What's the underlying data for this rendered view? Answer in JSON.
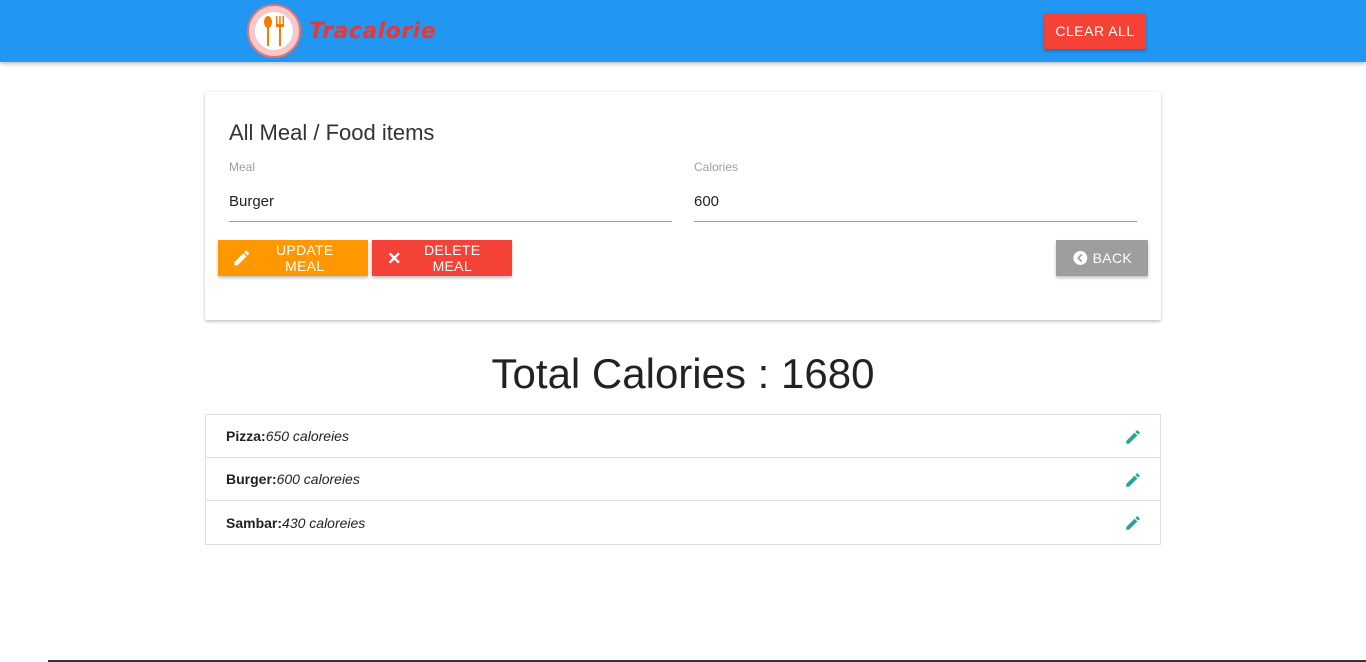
{
  "header": {
    "brand": "Tracalorie",
    "clear_all_label": "CLEAR ALL"
  },
  "form": {
    "title": "All Meal / Food items",
    "meal_label": "Meal",
    "meal_value": "Burger",
    "calories_label": "Calories",
    "calories_value": "600",
    "update_label": "UPDATE MEAL",
    "delete_label": "DELETE MEAL",
    "back_label": "BACK"
  },
  "total": {
    "text": "Total Calories : 1680"
  },
  "items": [
    {
      "name": "Pizza:",
      "calories": "650 caloreies"
    },
    {
      "name": "Burger:",
      "calories": "600 caloreies"
    },
    {
      "name": "Sambar:",
      "calories": "430 caloreies"
    }
  ],
  "colors": {
    "navbar": "#2196f3",
    "clear": "#f44336",
    "update": "#ff9800",
    "delete": "#f44336",
    "back": "#9e9e9e",
    "edit_icon": "#26a69a"
  },
  "icons": {
    "update": "pencil-icon",
    "delete": "close-icon",
    "back": "chevron-left-circle-icon",
    "edit": "pencil-icon"
  }
}
